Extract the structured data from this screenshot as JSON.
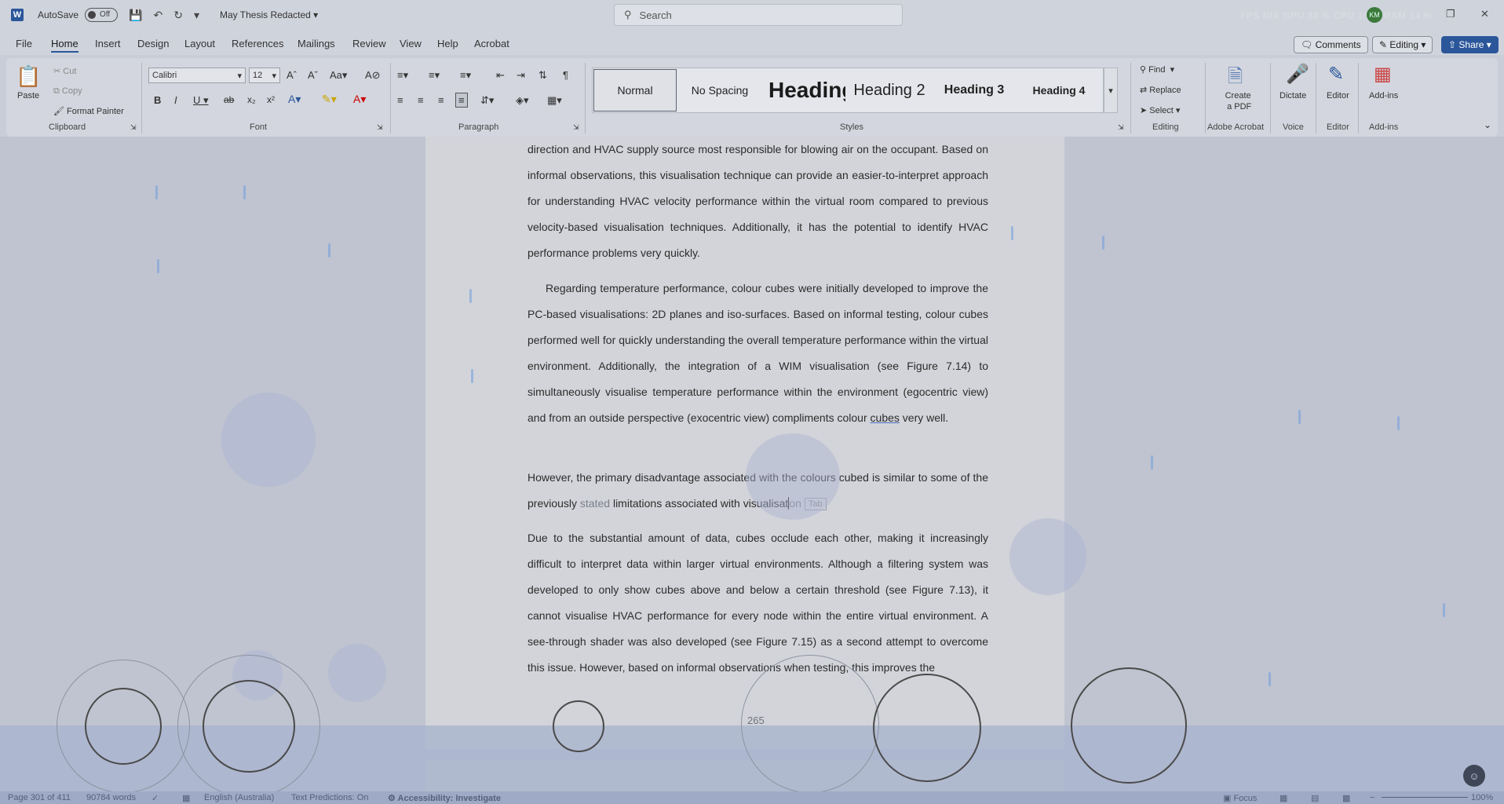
{
  "titlebar": {
    "autosave_label": "AutoSave",
    "autosave_state": "Off",
    "doc_title": "May Thesis Redacted",
    "search_placeholder": "Search",
    "stats": "FPS N/A   GPU 38 %   CPU 18 %   RAM 14 %",
    "avatar_initials": "KM"
  },
  "menu": {
    "tabs": [
      "File",
      "Home",
      "Insert",
      "Design",
      "Layout",
      "References",
      "Mailings",
      "Review",
      "View",
      "Help",
      "Acrobat"
    ],
    "active": "Home",
    "comments": "Comments",
    "editing": "Editing",
    "share": "Share"
  },
  "ribbon": {
    "clipboard": {
      "paste": "Paste",
      "cut": "Cut",
      "copy": "Copy",
      "format_painter": "Format Painter",
      "label": "Clipboard"
    },
    "font": {
      "family": "Calibri",
      "size": "12",
      "label": "Font"
    },
    "paragraph": {
      "label": "Paragraph"
    },
    "styles": {
      "items": [
        "Normal",
        "No Spacing",
        "Heading",
        "Heading 2",
        "Heading 3",
        "Heading 4"
      ],
      "label": "Styles"
    },
    "editing": {
      "find": "Find",
      "replace": "Replace",
      "select": "Select",
      "label": "Editing"
    },
    "acrobat": {
      "create_pdf_1": "Create",
      "create_pdf_2": "a PDF",
      "label": "Adobe Acrobat"
    },
    "voice": {
      "dictate": "Dictate",
      "label": "Voice"
    },
    "editor": {
      "editor": "Editor",
      "label": "Editor"
    },
    "addins": {
      "addins": "Add-ins",
      "label": "Add-ins"
    }
  },
  "document": {
    "p1": "direction and HVAC supply source most responsible for blowing air on the occupant. Based on informal observations, this visualisation technique can provide an easier-to-interpret approach for understanding HVAC velocity performance within the virtual room compared to previous velocity-based visualisation techniques. Additionally, it has the potential to identify HVAC performance problems very quickly.",
    "p2_a": "Regarding temperature performance, colour cubes were initially developed to improve the PC-based visualisations: 2D planes and iso-surfaces. Based on informal testing, colour cubes performed well for quickly understanding the overall temperature performance within the virtual environment. Additionally, the integration of a WIM visualisation (see Figure 7.14) to simultaneously visualise temperature performance within the environment (egocentric view) and from an outside perspective (exocentric view) compliments colour ",
    "p2_squiggle": "cubes",
    "p2_b": " very well.",
    "p3_a": "However, the primary disadvantage associated with the colours cubed is similar to some of the previously ",
    "p3_dim": "stated",
    "p3_b": " limitations associated with visualisat",
    "p3_c": "on",
    "p3_tab": "Tab",
    "p4": "Due to the substantial amount of data, cubes occlude each other, making it increasingly difficult to interpret data within larger virtual environments. Although a filtering system was developed to only show cubes above and below a certain threshold (see Figure 7.13), it cannot visualise HVAC performance for every node within the entire virtual environment. A see-through shader was also developed (see Figure 7.15) as a second attempt to overcome this issue. However, based on informal observations when testing, this improves the",
    "page_number": "265"
  },
  "status": {
    "page": "Page 301 of 411",
    "words": "90784 words",
    "language": "English (Australia)",
    "predictions": "Text Predictions: On",
    "accessibility": "Accessibility: Investigate",
    "focus": "Focus",
    "zoom": "100%"
  }
}
